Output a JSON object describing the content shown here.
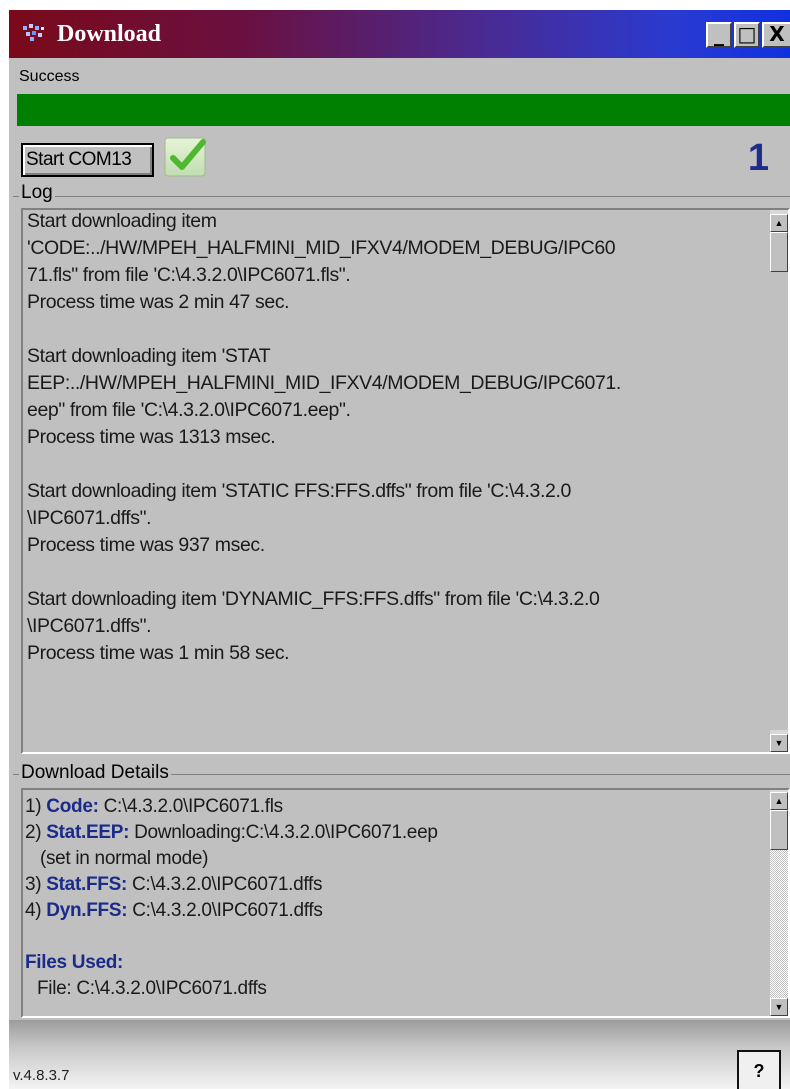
{
  "window": {
    "title": "Download",
    "controls": {
      "minimize": "_",
      "maximize": "□",
      "close": "X"
    }
  },
  "status": {
    "label": "Success",
    "progress_percent": 100,
    "progress_color": "#008000"
  },
  "toolbar": {
    "start_button": "Start COM13",
    "status_icon": "green-check-icon",
    "counter": "1"
  },
  "log": {
    "title": "Log",
    "lines": [
      "Start downloading item",
      "'CODE:../HW/MPEH_HALFMINI_MID_IFXV4/MODEM_DEBUG/IPC60",
      "71.fls\" from file 'C:\\4.3.2.0\\IPC6071.fls\".",
      "Process time was 2 min 47  sec.",
      "",
      "Start downloading item 'STAT",
      "EEP:../HW/MPEH_HALFMINI_MID_IFXV4/MODEM_DEBUG/IPC6071.",
      "eep\" from file 'C:\\4.3.2.0\\IPC6071.eep\".",
      "Process time was 1313 msec.",
      "",
      "Start downloading item 'STATIC FFS:FFS.dffs\" from file 'C:\\4.3.2.0",
      "\\IPC6071.dffs\".",
      "Process time was 937 msec.",
      "",
      "Start downloading item 'DYNAMIC_FFS:FFS.dffs\" from file 'C:\\4.3.2.0",
      "\\IPC6071.dffs\".",
      "Process time was 1 min 58  sec."
    ]
  },
  "details": {
    "title": "Download Details",
    "items": [
      {
        "prefix": "1) ",
        "key": "Code:",
        "value": " C:\\4.3.2.0\\IPC6071.fls"
      },
      {
        "prefix": "2) ",
        "key": "Stat.EEP:",
        "value": " Downloading:C:\\4.3.2.0\\IPC6071.eep"
      },
      {
        "prefix": "   ",
        "key": "",
        "value": "(set in normal mode)"
      },
      {
        "prefix": "3) ",
        "key": "Stat.FFS:",
        "value": " C:\\4.3.2.0\\IPC6071.dffs"
      },
      {
        "prefix": "4) ",
        "key": "Dyn.FFS:",
        "value": " C:\\4.3.2.0\\IPC6071.dffs"
      }
    ],
    "files_used_label": "Files Used:",
    "files": [
      "File: C:\\4.3.2.0\\IPC6071.dffs"
    ]
  },
  "footer": {
    "version": "v.4.8.3.7",
    "help_button": "?"
  }
}
